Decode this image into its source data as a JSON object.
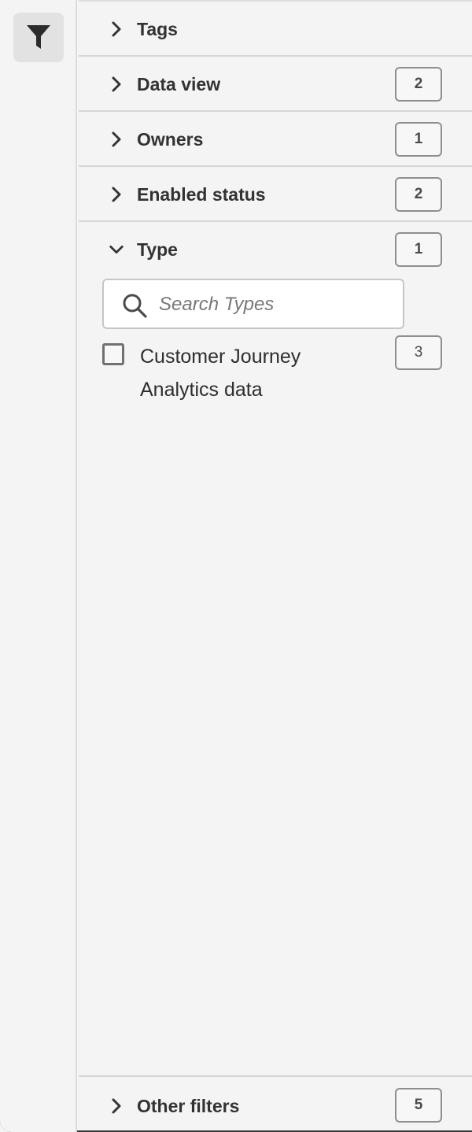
{
  "rail": {
    "filter_icon": "filter-icon"
  },
  "sections": [
    {
      "label": "Tags",
      "count": "",
      "expanded": false
    },
    {
      "label": "Data view",
      "count": "2",
      "expanded": false
    },
    {
      "label": "Owners",
      "count": "1",
      "expanded": false
    },
    {
      "label": "Enabled status",
      "count": "2",
      "expanded": false
    }
  ],
  "type_section": {
    "label": "Type",
    "count": "1",
    "expanded": true,
    "search_placeholder": "Search Types",
    "search_value": "",
    "options": [
      {
        "label": "Customer Journey Analytics data",
        "count": "3",
        "checked": false
      }
    ]
  },
  "other_filters": {
    "label": "Other filters",
    "count": "5",
    "expanded": false
  },
  "icons": {
    "collapsed": "chevron-right-icon",
    "expanded": "chevron-down-icon",
    "search": "search-icon"
  },
  "colors": {
    "background": "#f4f4f4",
    "divider": "#d6d6d6",
    "badge_border": "#8e8e8e",
    "filter_button_bg": "#e2e2e2"
  }
}
